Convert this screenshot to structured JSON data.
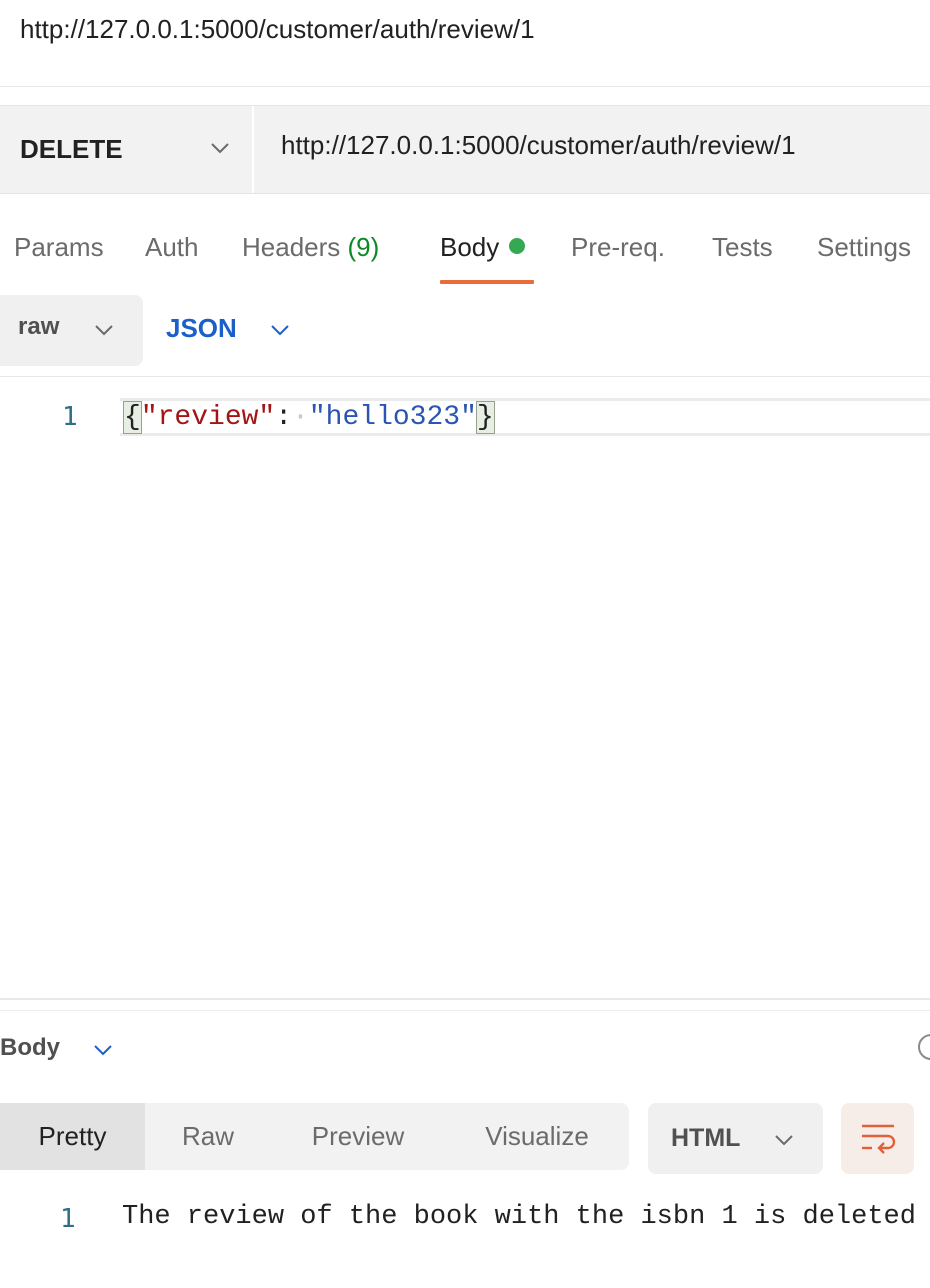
{
  "request": {
    "title": "http://127.0.0.1:5000/customer/auth/review/1",
    "method": "DELETE",
    "url": "http://127.0.0.1:5000/customer/auth/review/1"
  },
  "tabs": {
    "params": "Params",
    "auth": "Auth",
    "headers": "Headers",
    "headers_count": "(9)",
    "body": "Body",
    "prereq": "Pre-req.",
    "tests": "Tests",
    "settings": "Settings",
    "active": "Body",
    "body_indicator_color": "#34a853",
    "active_underline_color": "#eb6b3b"
  },
  "body_options": {
    "mode": "raw",
    "language": "JSON"
  },
  "editor": {
    "line_number": "1",
    "open_brace": "{",
    "key": "\"review\"",
    "colon": ":",
    "value": "\"hello323\"",
    "close_brace": "}"
  },
  "response": {
    "section_label": "Body",
    "view_tabs": [
      "Pretty",
      "Raw",
      "Preview",
      "Visualize"
    ],
    "active_view": "Pretty",
    "format": "HTML",
    "line_number": "1",
    "text": "The review of the book with the isbn 1 is deleted"
  },
  "icons": {
    "method_dropdown": "chevron-down-icon",
    "wrap_lines": "wrap-lines-icon",
    "globe": "globe-icon"
  }
}
